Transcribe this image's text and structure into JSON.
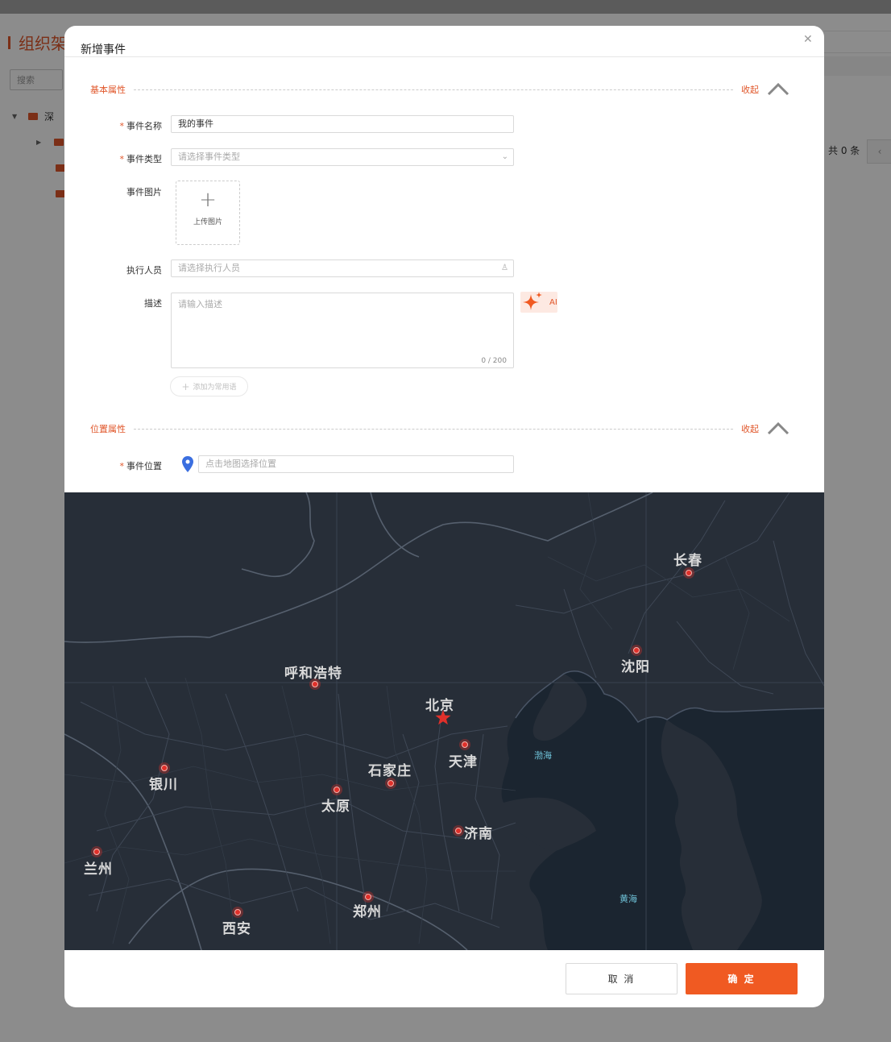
{
  "background": {
    "page_title": "组织架",
    "search_placeholder": "搜索",
    "tree_root_label": "深",
    "total_count": "共 0 条",
    "prev_page_icon": "chevron-left-icon"
  },
  "modal": {
    "title": "新增事件",
    "close_icon": "close-icon",
    "basic_section": {
      "label": "基本属性",
      "collapse_label": "收起"
    },
    "fields": {
      "event_name": {
        "label": "事件名称",
        "value": "我的事件",
        "required": true
      },
      "event_type": {
        "label": "事件类型",
        "placeholder": "请选择事件类型",
        "required": true
      },
      "event_image": {
        "label": "事件图片",
        "upload_label": "上传图片"
      },
      "executor": {
        "label": "执行人员",
        "placeholder": "请选择执行人员"
      },
      "description": {
        "label": "描述",
        "placeholder": "请输入描述",
        "counter": "0 / 200"
      }
    },
    "ai_button_label": "AI",
    "add_phrase_label": "添加为常用语",
    "location_section": {
      "label": "位置属性",
      "collapse_label": "收起"
    },
    "location_field": {
      "label": "事件位置",
      "placeholder": "点击地图选择位置",
      "required": true
    },
    "map": {
      "cities": [
        "长春",
        "沈阳",
        "呼和浩特",
        "北京",
        "天津",
        "石家庄",
        "银川",
        "太原",
        "济南",
        "兰州",
        "郑州",
        "西安"
      ],
      "seas": [
        "渤海",
        "黄海"
      ],
      "capital": "北京"
    },
    "footer": {
      "cancel_label": "取 消",
      "confirm_label": "确 定"
    }
  },
  "colors": {
    "accent": "#f05a22",
    "map_land": "#272e38",
    "map_sea": "#1b2530",
    "city_marker": "#e0302a"
  }
}
